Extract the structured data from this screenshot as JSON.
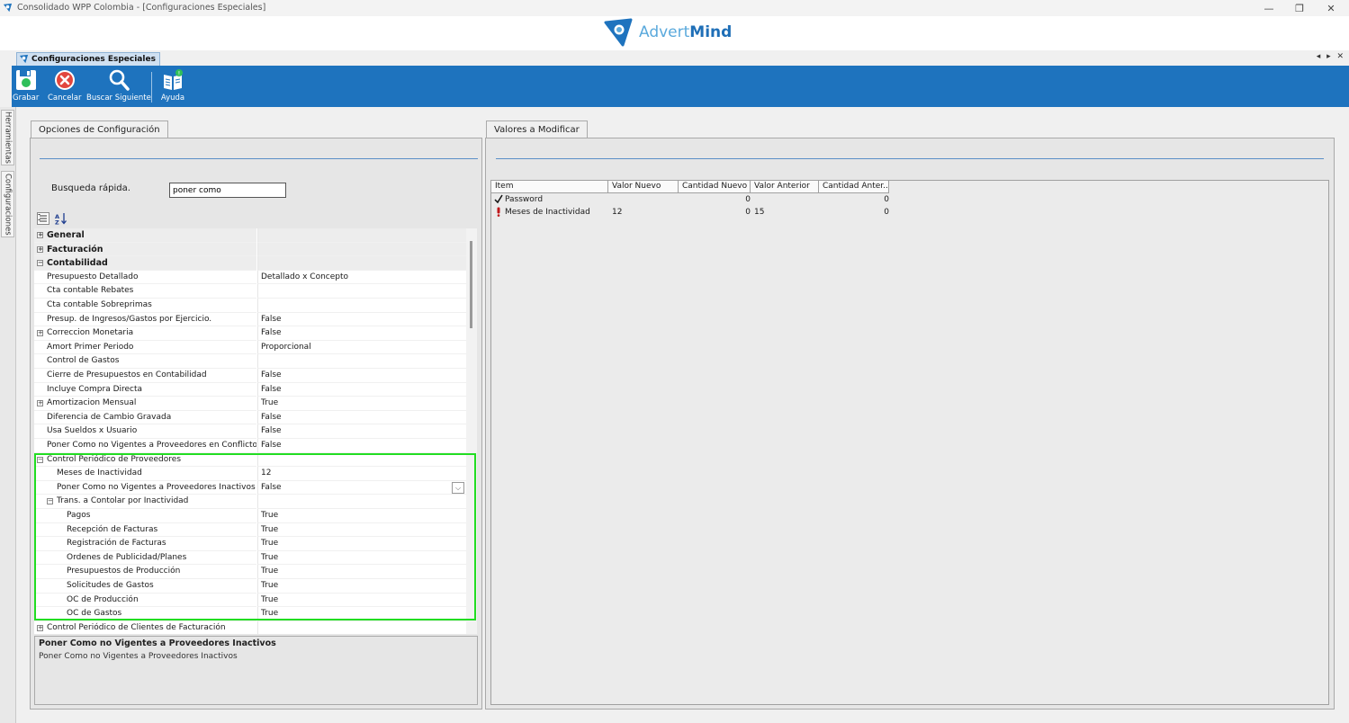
{
  "window": {
    "title": "Consolidado WPP Colombia - [Configuraciones Especiales]",
    "controls": [
      "minimize",
      "restore",
      "close"
    ]
  },
  "logo": {
    "part1": "Advert",
    "part2": "Mind"
  },
  "doc_tab": {
    "label": "Configuraciones Especiales"
  },
  "tab_nav": "◂ ▸ ✕",
  "ribbon": {
    "buttons": [
      {
        "id": "grabar",
        "label": "Grabar",
        "icon": "save-icon"
      },
      {
        "id": "cancelar",
        "label": "Cancelar",
        "icon": "cancel-icon"
      },
      {
        "id": "buscar",
        "label": "Buscar Siguiente",
        "icon": "search-icon"
      },
      {
        "id": "ayuda",
        "label": "Ayuda",
        "icon": "help-book-icon"
      }
    ]
  },
  "side_tabs": [
    "Herramientas",
    "Configuraciones"
  ],
  "left_panel": {
    "tab": "Opciones de Configuración",
    "search_label": "Busqueda rápida.",
    "search_value": "poner como",
    "rows": [
      {
        "name": "General",
        "value": "",
        "category": true,
        "expander": "+",
        "indent": 0
      },
      {
        "name": "Facturación",
        "value": "",
        "category": true,
        "expander": "+",
        "indent": 0
      },
      {
        "name": "Contabilidad",
        "value": "",
        "category": true,
        "expander": "−",
        "indent": 0
      },
      {
        "name": "Presupuesto Detallado",
        "value": "Detallado x Concepto",
        "indent": 0
      },
      {
        "name": "Cta contable Rebates",
        "value": "",
        "indent": 0
      },
      {
        "name": "Cta contable Sobreprimas",
        "value": "",
        "indent": 0
      },
      {
        "name": "Presup. de Ingresos/Gastos por Ejercicio.",
        "value": "False",
        "indent": 0
      },
      {
        "name": "Correccion Monetaria",
        "value": "False",
        "expander": "+",
        "indent": 0
      },
      {
        "name": "Amort Primer Periodo",
        "value": "Proporcional",
        "indent": 0
      },
      {
        "name": "Control de Gastos",
        "value": "",
        "indent": 0
      },
      {
        "name": "Cierre de Presupuestos en Contabilidad",
        "value": "False",
        "indent": 0
      },
      {
        "name": "Incluye Compra Directa",
        "value": "False",
        "indent": 0
      },
      {
        "name": "Amortizacion Mensual",
        "value": "True",
        "expander": "+",
        "indent": 0
      },
      {
        "name": "Diferencia de Cambio Gravada",
        "value": "False",
        "indent": 0
      },
      {
        "name": "Usa Sueldos x Usuario",
        "value": "False",
        "indent": 0
      },
      {
        "name": "Poner Como no Vigentes a Proveedores en Conflicto",
        "value": "False",
        "indent": 0
      },
      {
        "name": "Control Periódico de Proveedores",
        "value": "",
        "expander": "−",
        "indent": 0
      },
      {
        "name": "Meses de Inactividad",
        "value": "12",
        "indent": 1
      },
      {
        "name": "Poner Como no Vigentes a Proveedores Inactivos",
        "value": "False",
        "indent": 1,
        "dropdown": true
      },
      {
        "name": "Trans. a Contolar por Inactividad",
        "value": "",
        "expander": "−",
        "indent": 1
      },
      {
        "name": "Pagos",
        "value": "True",
        "indent": 2
      },
      {
        "name": "Recepción de Facturas",
        "value": "True",
        "indent": 2
      },
      {
        "name": "Registración de Facturas",
        "value": "True",
        "indent": 2
      },
      {
        "name": "Ordenes de Publicidad/Planes",
        "value": "True",
        "indent": 2
      },
      {
        "name": "Presupuestos de Producción",
        "value": "True",
        "indent": 2
      },
      {
        "name": "Solicitudes de Gastos",
        "value": "True",
        "indent": 2
      },
      {
        "name": "OC de Producción",
        "value": "True",
        "indent": 2
      },
      {
        "name": "OC de Gastos",
        "value": "True",
        "indent": 2
      },
      {
        "name": "Control Periódico de Clientes de Facturación",
        "value": "",
        "expander": "+",
        "indent": 0
      }
    ],
    "description_title": "Poner Como no Vigentes a Proveedores Inactivos",
    "description_text": "Poner Como no Vigentes a Proveedores Inactivos",
    "highlight_color": "#22dd22"
  },
  "right_panel": {
    "tab": "Valores a Modificar",
    "columns": [
      "Item",
      "Valor Nuevo",
      "Cantidad Nuevo",
      "Valor Anterior",
      "Cantidad Anter..."
    ],
    "rows": [
      {
        "icon": "check-icon",
        "item": "Password",
        "valor_nuevo": "",
        "cantidad_nuevo": "0",
        "valor_anterior": "",
        "cantidad_anterior": "0"
      },
      {
        "icon": "exclamation-icon",
        "item": "Meses de Inactividad",
        "valor_nuevo": "12",
        "cantidad_nuevo": "0",
        "valor_anterior": "15",
        "cantidad_anterior": "0"
      }
    ]
  },
  "colors": {
    "ribbon": "#1e73be",
    "accent": "#5b8fc7"
  }
}
